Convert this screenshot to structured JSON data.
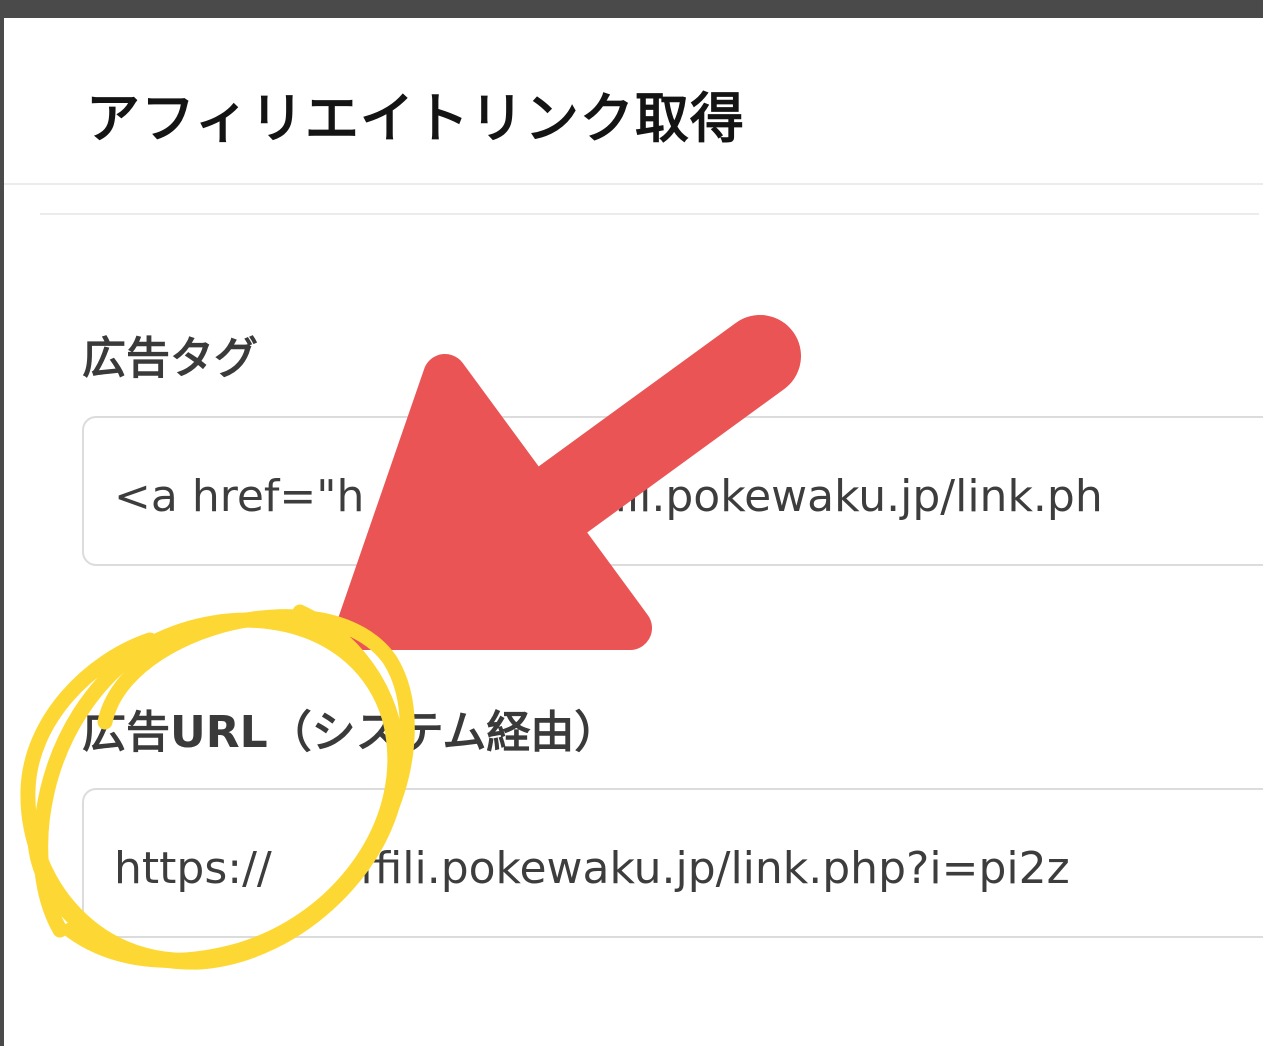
{
  "modal": {
    "title": "アフィリエイトリンク取得"
  },
  "fields": [
    {
      "label": "広告タグ",
      "value": "<a href=\"h　　　　　ffili.pokewaku.jp/link.ph"
    },
    {
      "label": "広告URL（システム経由）",
      "value": "https://　　ffili.pokewaku.jp/link.php?i=pi2z"
    }
  ],
  "annotations": {
    "arrow_color": "#eb5454",
    "circle_color": "#fdd835"
  }
}
